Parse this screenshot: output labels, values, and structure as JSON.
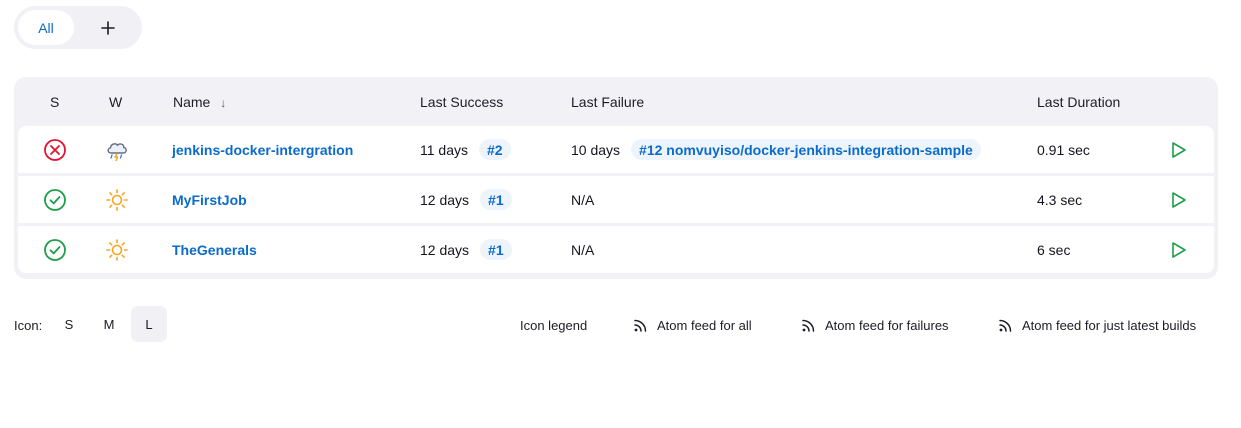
{
  "tabs": {
    "all_label": "All",
    "add_icon": "plus-icon"
  },
  "table": {
    "headers": {
      "status": "S",
      "weather": "W",
      "name": "Name",
      "name_sort": "↓",
      "last_success": "Last Success",
      "last_failure": "Last Failure",
      "last_duration": "Last Duration"
    },
    "rows": [
      {
        "status_icon": "failed-x-icon",
        "weather_icon": "storm-cloud-icon",
        "name": "jenkins-docker-intergration",
        "last_success_time": "11 days",
        "last_success_build": "#2",
        "last_failure_time": "10 days",
        "last_failure_build": "#12 nomvuyiso/docker-jenkins-integration-sample",
        "last_duration": "0.91 sec"
      },
      {
        "status_icon": "success-check-icon",
        "weather_icon": "sunny-icon",
        "name": "MyFirstJob",
        "last_success_time": "12 days",
        "last_success_build": "#1",
        "last_failure_time": "N/A",
        "last_failure_build": "",
        "last_duration": "4.3 sec"
      },
      {
        "status_icon": "success-check-icon",
        "weather_icon": "sunny-icon",
        "name": "TheGenerals",
        "last_success_time": "12 days",
        "last_success_build": "#1",
        "last_failure_time": "N/A",
        "last_failure_build": "",
        "last_duration": "6 sec"
      }
    ]
  },
  "footer": {
    "icon_label": "Icon:",
    "sizes": [
      "S",
      "M",
      "L"
    ],
    "active_size": "L",
    "icon_legend": "Icon legend",
    "feed_all": "Atom feed for all",
    "feed_failures": "Atom feed for failures",
    "feed_latest": "Atom feed for just latest builds"
  },
  "colors": {
    "accent": "#0b6bcb",
    "failure": "#e2142e",
    "success": "#1e9f4a",
    "sun": "#f5a524",
    "table_bg": "#f2f2f6"
  }
}
